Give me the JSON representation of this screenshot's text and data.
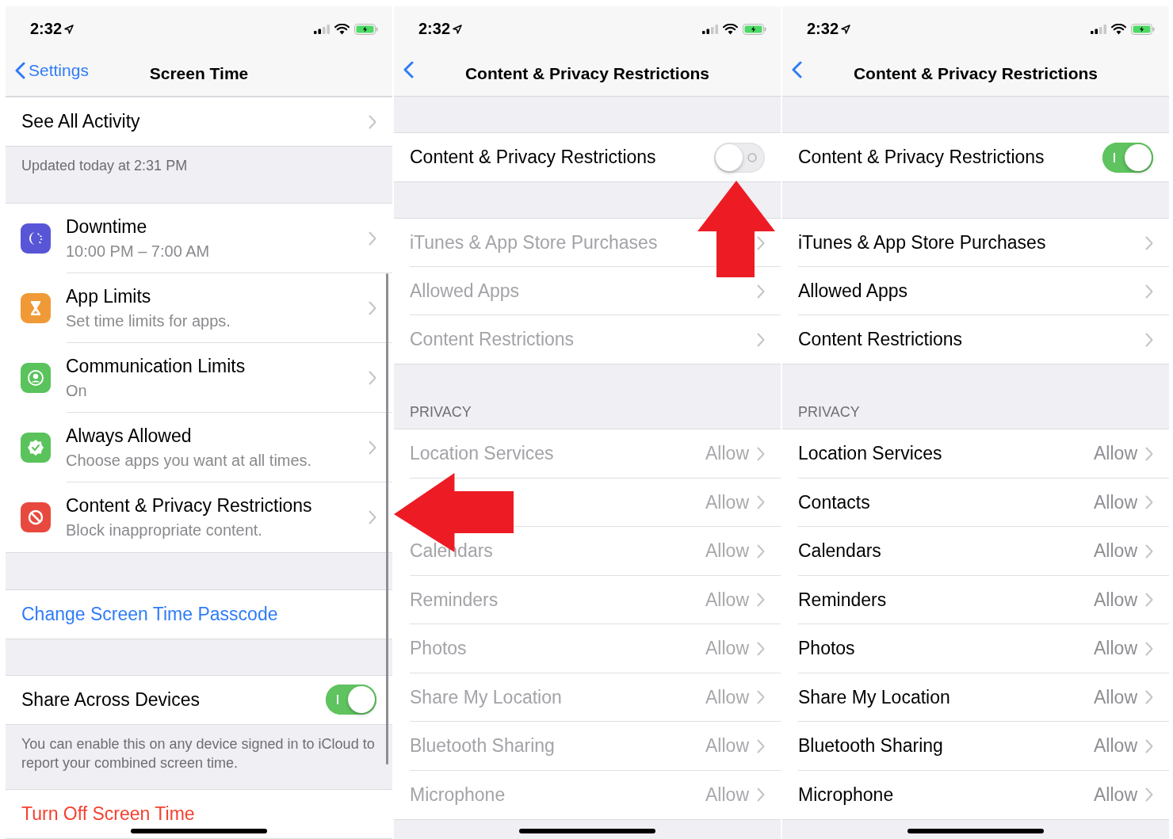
{
  "screens": [
    {
      "kind": "screen_time",
      "status_bar": {
        "time": "2:32"
      },
      "nav": {
        "back": "Settings",
        "title": "Screen Time"
      },
      "see_all": "See All Activity",
      "updated": "Updated today at 2:31 PM",
      "features": [
        {
          "kind": "downtime",
          "color": "#5856d6",
          "title": "Downtime",
          "subtitle": "10:00 PM – 7:00 AM"
        },
        {
          "kind": "app_limits",
          "color": "#f09a37",
          "title": "App Limits",
          "subtitle": "Set time limits for apps."
        },
        {
          "kind": "communication",
          "color": "#5ac35c",
          "title": "Communication Limits",
          "subtitle": "On"
        },
        {
          "kind": "always_allowed",
          "color": "#5ac35c",
          "title": "Always Allowed",
          "subtitle": "Choose apps you want at all times."
        },
        {
          "kind": "content",
          "color": "#e8493e",
          "title": "Content & Privacy Restrictions",
          "subtitle": "Block inappropriate content."
        }
      ],
      "passcode_link": "Change Screen Time Passcode",
      "share": {
        "label": "Share Across Devices",
        "on": true
      },
      "share_note": "You can enable this on any device signed in to iCloud to report your combined screen time.",
      "turn_off": "Turn Off Screen Time"
    },
    {
      "kind": "restrictions",
      "status_bar": {
        "time": "2:32"
      },
      "nav": {
        "title": "Content & Privacy Restrictions"
      },
      "master": {
        "label": "Content & Privacy Restrictions",
        "on": false
      },
      "store_rows": [
        {
          "label": "iTunes & App Store Purchases",
          "disabled": true
        },
        {
          "label": "Allowed Apps",
          "disabled": true
        },
        {
          "label": "Content Restrictions",
          "disabled": true
        }
      ],
      "privacy_header": "PRIVACY",
      "privacy_rows": [
        {
          "label": "Location Services",
          "value": "Allow",
          "disabled": true
        },
        {
          "value": "Allow",
          "disabled": true
        },
        {
          "label": "Calendars",
          "value": "Allow",
          "disabled": true
        },
        {
          "label": "Reminders",
          "value": "Allow",
          "disabled": true
        },
        {
          "label": "Photos",
          "value": "Allow",
          "disabled": true
        },
        {
          "label": "Share My Location",
          "value": "Allow",
          "disabled": true
        },
        {
          "label": "Bluetooth Sharing",
          "value": "Allow",
          "disabled": true
        },
        {
          "label": "Microphone",
          "value": "Allow",
          "disabled": true
        }
      ]
    },
    {
      "kind": "restrictions",
      "status_bar": {
        "time": "2:32"
      },
      "nav": {
        "title": "Content & Privacy Restrictions"
      },
      "master": {
        "label": "Content & Privacy Restrictions",
        "on": true
      },
      "store_rows": [
        {
          "label": "iTunes & App Store Purchases",
          "disabled": false
        },
        {
          "label": "Allowed Apps",
          "disabled": false
        },
        {
          "label": "Content Restrictions",
          "disabled": false
        }
      ],
      "privacy_header": "PRIVACY",
      "privacy_rows": [
        {
          "label": "Location Services",
          "value": "Allow",
          "disabled": false
        },
        {
          "label": "Contacts",
          "value": "Allow",
          "disabled": false
        },
        {
          "label": "Calendars",
          "value": "Allow",
          "disabled": false
        },
        {
          "label": "Reminders",
          "value": "Allow",
          "disabled": false
        },
        {
          "label": "Photos",
          "value": "Allow",
          "disabled": false
        },
        {
          "label": "Share My Location",
          "value": "Allow",
          "disabled": false
        },
        {
          "label": "Bluetooth Sharing",
          "value": "Allow",
          "disabled": false
        },
        {
          "label": "Microphone",
          "value": "Allow",
          "disabled": false
        }
      ]
    }
  ]
}
